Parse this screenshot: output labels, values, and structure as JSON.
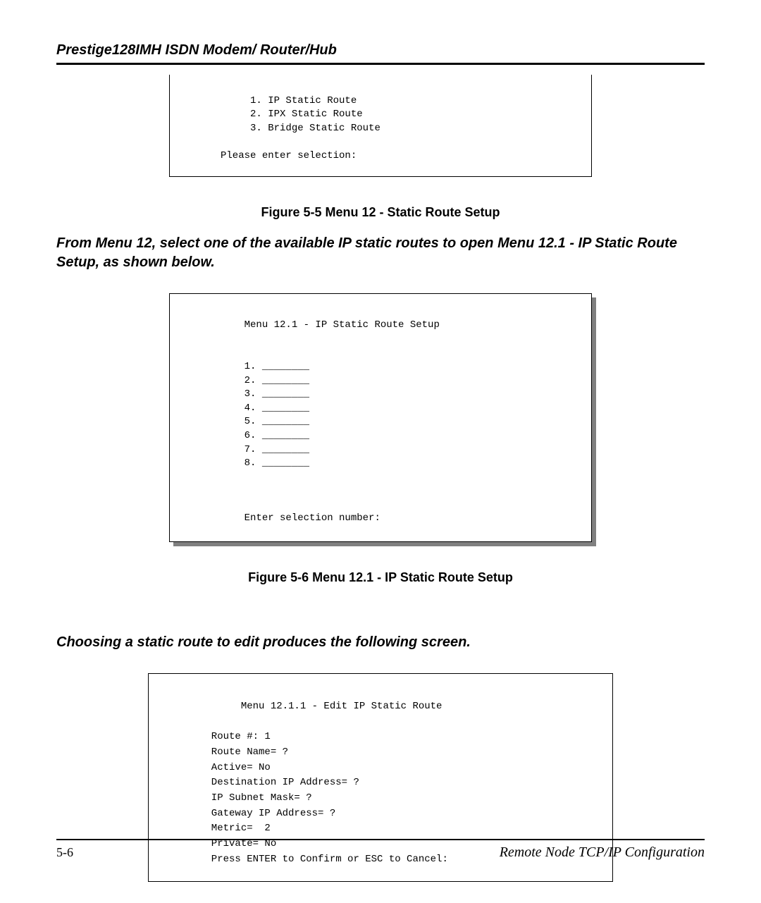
{
  "header": {
    "title": "Prestige128IMH ISDN Modem/ Router/Hub"
  },
  "menu12": {
    "line1": "          1. IP Static Route",
    "line2": "          2. IPX Static Route",
    "line3": "          3. Bridge Static Route",
    "prompt": "     Please enter selection:"
  },
  "fig55": "Figure 5-5 Menu 12 - Static Route Setup",
  "para1": "From Menu 12, select one of the available IP static routes to open Menu 12.1 - IP Static Route Setup, as shown below.",
  "menu121": {
    "title": "         Menu 12.1 - IP Static Route Setup",
    "item1": "         1. ________",
    "item2": "         2. ________",
    "item3": "         3. ________",
    "item4": "         4. ________",
    "item5": "         5. ________",
    "item6": "         6. ________",
    "item7": "         7. ________",
    "item8": "         8. ________",
    "prompt": "         Enter selection number:"
  },
  "fig56": "Figure 5-6 Menu 12.1 - IP Static Route Setup",
  "para2": "Choosing a static route to edit produces the following screen.",
  "menu1211": {
    "title": "            Menu 12.1.1 - Edit IP Static Route",
    "l1": "       Route #: 1",
    "l2": "       Route Name= ?",
    "l3": "       Active= No",
    "l4": "       Destination IP Address= ?",
    "l5": "       IP Subnet Mask= ?",
    "l6": "       Gateway IP Address= ?",
    "l7": "       Metric=  2",
    "l8": "       Private= No",
    "confirm": "       Press ENTER to Confirm or ESC to Cancel:"
  },
  "footer": {
    "page": "5-6",
    "title": "Remote Node TCP/IP Configuration"
  }
}
